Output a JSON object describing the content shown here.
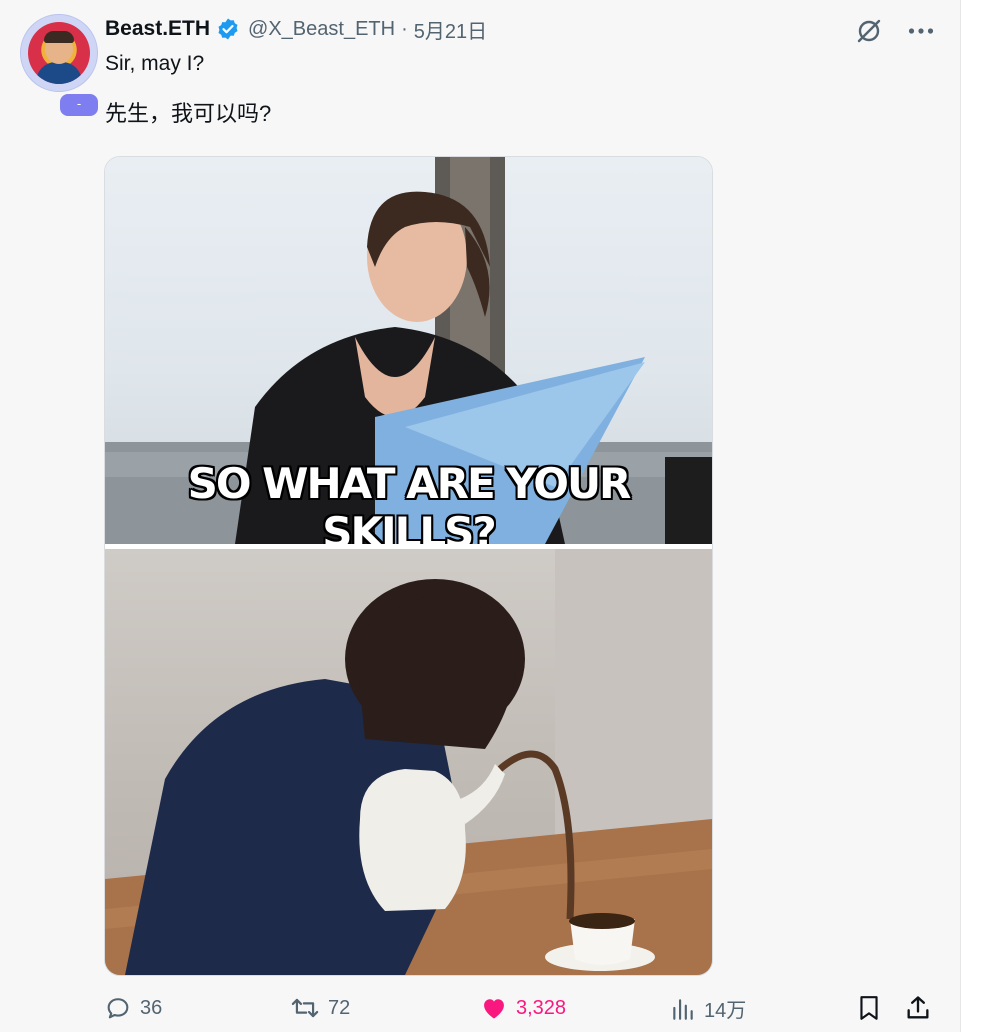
{
  "author": {
    "name": "Beast.ETH",
    "handle": "@X_Beast_ETH",
    "separator": "·",
    "date": "5月21日",
    "badge": "-"
  },
  "post": {
    "text_en": "Sir, may I?",
    "text_zh": "先生，我可以吗?"
  },
  "media": {
    "caption": "SO WHAT ARE YOUR SKILLS?"
  },
  "stats": {
    "replies": "36",
    "reposts": "72",
    "likes": "3,328",
    "views": "14万"
  },
  "colors": {
    "like": "#f91880",
    "verified": "#1d9bf0",
    "muted": "#536471"
  },
  "icons": [
    "grok-icon",
    "more-icon",
    "reply-icon",
    "repost-icon",
    "like-icon",
    "views-icon",
    "bookmark-icon",
    "share-icon",
    "verified-icon"
  ]
}
